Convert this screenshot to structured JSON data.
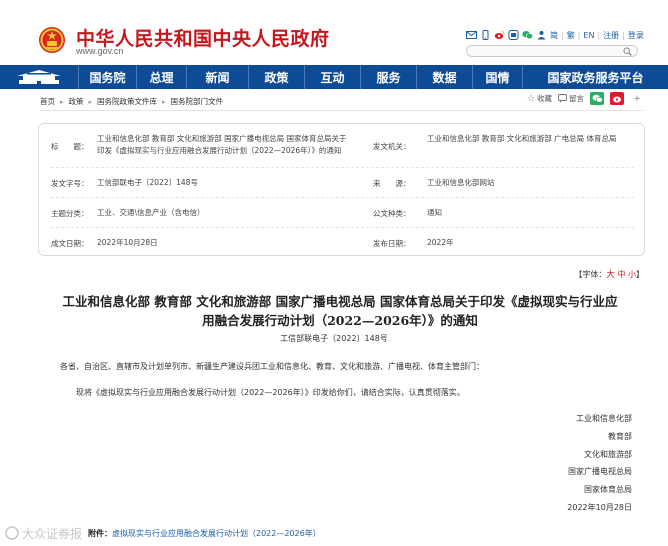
{
  "header": {
    "site_title": "中华人民共和国中央人民政府",
    "site_url": "www.gov.cn",
    "top_links": [
      "简",
      "繁",
      "EN",
      "注册",
      "登录"
    ],
    "search_placeholder": ""
  },
  "nav": {
    "items": [
      "国务院",
      "总理",
      "新闻",
      "政策",
      "互动",
      "服务",
      "数据",
      "国情",
      "国家政务服务平台"
    ]
  },
  "breadcrumb": [
    "首页",
    "政策",
    "国务院政策文件库",
    "国务院部门文件"
  ],
  "tools": {
    "favorite": "收藏",
    "comment": "留言"
  },
  "info": {
    "title_label": "标　　题：",
    "title_value": "工业和信息化部 教育部 文化和旅游部 国家广播电视总局 国家体育总局关于印发《虚拟现实与行业应用融合发展行动计划（2022—2026年）》的通知",
    "issuer_label": "发文机关：",
    "issuer_value": "工业和信息化部 教育部 文化和旅游部 广电总局 体育总局",
    "docno_label": "发文字号：",
    "docno_value": "工信部联电子〔2022〕148号",
    "source_label": "来　　源：",
    "source_value": "工业和信息化部网站",
    "topic_label": "主题分类：",
    "topic_value": "工业、交通\\信息产业（含电信）",
    "type_label": "公文种类：",
    "type_value": "通知",
    "written_label": "成文日期：",
    "written_value": "2022年10月28日",
    "published_label": "发布日期：",
    "published_value": "2022年"
  },
  "font_size": {
    "label": "【字体：",
    "large": "大",
    "medium": "中",
    "small": "小",
    "end": "】"
  },
  "article": {
    "title": "工业和信息化部 教育部 文化和旅游部 国家广播电视总局 国家体育总局关于印发《虚拟现实与行业应用融合发展行动计划（2022—2026年）》的通知",
    "doc_no": "工信部联电子〔2022〕148号",
    "recipients": "各省、自治区、直辖市及计划单列市、新疆生产建设兵团工业和信息化、教育、文化和旅游、广播电视、体育主管部门：",
    "body": "现将《虚拟现实与行业应用融合发展行动计划（2022—2026年）》印发给你们，请结合实际，认真贯彻落实。",
    "signatures": [
      "工业和信息化部",
      "教育部",
      "文化和旅游部",
      "国家广播电视总局",
      "国家体育总局",
      "2022年10月28日"
    ],
    "attachment_label": "附件：",
    "attachment_link": "虚拟现实与行业应用融合发展行动计划（2022—2026年）"
  },
  "watermark": "大众证券报",
  "colors": {
    "brand_red": "#c8161d",
    "nav_blue": "#0e4b97",
    "link_blue": "#1b5ea8"
  }
}
